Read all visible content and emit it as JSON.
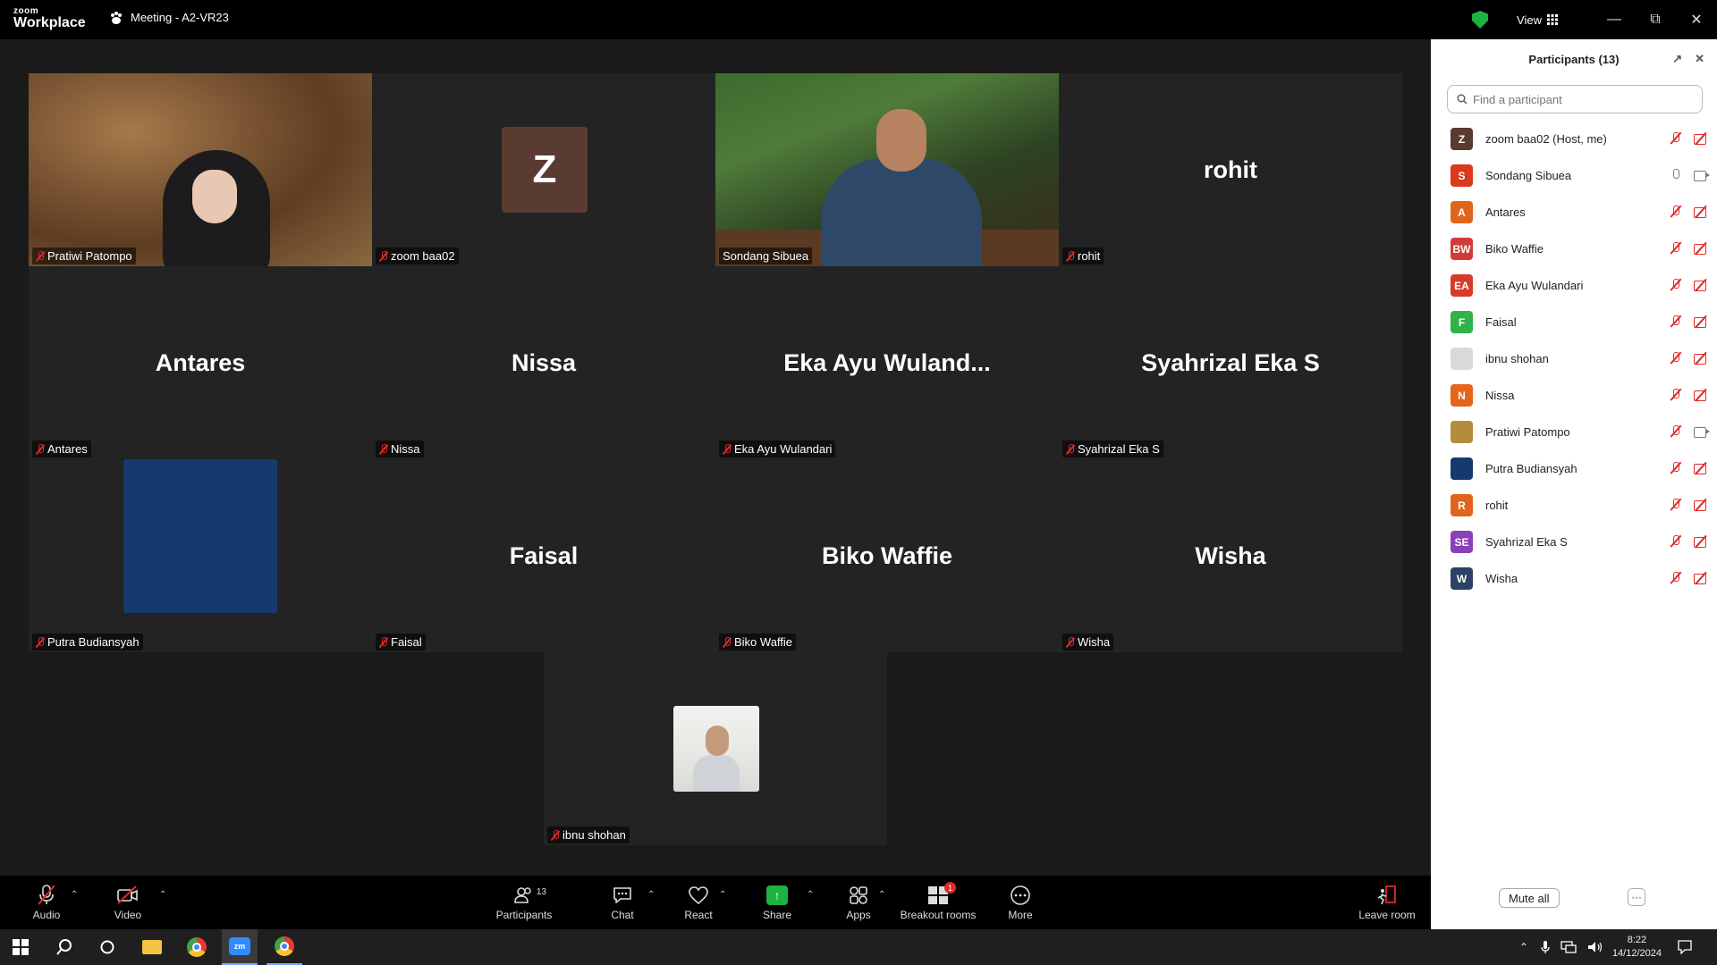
{
  "app": {
    "logo_line1": "zoom",
    "logo_line2": "Workplace",
    "meeting_title": "Meeting - A2-VR23",
    "view_label": "View",
    "accent_green": "#25d366",
    "mute_red": "#e02828"
  },
  "tiles": [
    {
      "id": "pratiwi",
      "tag": "Pratiwi Patompo",
      "big": "",
      "type": "video"
    },
    {
      "id": "zoom",
      "tag": "zoom baa02",
      "big": "",
      "avatar_letter": "Z",
      "type": "avatar"
    },
    {
      "id": "sondang",
      "tag": "Sondang Sibuea",
      "big": "",
      "type": "video",
      "active": true
    },
    {
      "id": "rohit",
      "tag": "rohit",
      "big": "rohit",
      "type": "name"
    },
    {
      "id": "antares",
      "tag": "Antares",
      "big": "Antares",
      "type": "name"
    },
    {
      "id": "nissa",
      "tag": "Nissa",
      "big": "Nissa",
      "type": "name"
    },
    {
      "id": "eka",
      "tag": "Eka Ayu Wulandari",
      "big": "Eka Ayu Wuland...",
      "type": "name"
    },
    {
      "id": "syahrizal",
      "tag": "Syahrizal Eka S",
      "big": "Syahrizal Eka S",
      "type": "name"
    },
    {
      "id": "putra",
      "tag": "Putra Budiansyah",
      "big": "",
      "type": "blue"
    },
    {
      "id": "faisal",
      "tag": "Faisal",
      "big": "Faisal",
      "type": "name"
    },
    {
      "id": "biko",
      "tag": "Biko Waffie",
      "big": "Biko Waffie",
      "type": "name"
    },
    {
      "id": "wisha",
      "tag": "Wisha",
      "big": "Wisha",
      "type": "name"
    },
    {
      "id": "ibnu",
      "tag": "ibnu shohan",
      "big": "",
      "type": "photo"
    }
  ],
  "panel": {
    "title": "Participants (13)",
    "search_placeholder": "Find a participant",
    "mute_all": "Mute all",
    "more": "···",
    "participants": [
      {
        "avatar": "Z",
        "color": "#5a3b32",
        "name": "zoom baa02 (Host, me)",
        "mic": "muted",
        "cam": "off"
      },
      {
        "avatar": "S",
        "color": "#d93b1c",
        "name": "Sondang Sibuea",
        "mic": "on",
        "cam": "on"
      },
      {
        "avatar": "A",
        "color": "#e0651a",
        "name": "Antares",
        "mic": "muted",
        "cam": "off"
      },
      {
        "avatar": "BW",
        "color": "#d23a3a",
        "name": "Biko Waffie",
        "mic": "muted",
        "cam": "off"
      },
      {
        "avatar": "EA",
        "color": "#d63b2a",
        "name": "Eka Ayu Wulandari",
        "mic": "muted",
        "cam": "off"
      },
      {
        "avatar": "F",
        "color": "#2fb34a",
        "name": "Faisal",
        "mic": "muted",
        "cam": "off"
      },
      {
        "avatar": "",
        "color": "#d9d9d9",
        "name": "ibnu shohan",
        "mic": "muted",
        "cam": "off"
      },
      {
        "avatar": "N",
        "color": "#e4651b",
        "name": "Nissa",
        "mic": "muted",
        "cam": "off"
      },
      {
        "avatar": "",
        "color": "#b58b3d",
        "name": "Pratiwi Patompo",
        "mic": "muted",
        "cam": "on"
      },
      {
        "avatar": "",
        "color": "#173a6e",
        "name": "Putra Budiansyah",
        "mic": "muted",
        "cam": "off"
      },
      {
        "avatar": "R",
        "color": "#e0651a",
        "name": "rohit",
        "mic": "muted",
        "cam": "off"
      },
      {
        "avatar": "SE",
        "color": "#8b3fb8",
        "name": "Syahrizal Eka S",
        "mic": "muted",
        "cam": "off"
      },
      {
        "avatar": "W",
        "color": "#2c4163",
        "name": "Wisha",
        "mic": "muted",
        "cam": "off"
      }
    ]
  },
  "toolbar": {
    "audio": "Audio",
    "video": "Video",
    "participants": "Participants",
    "participants_count": "13",
    "chat": "Chat",
    "react": "React",
    "share": "Share",
    "apps": "Apps",
    "breakout": "Breakout rooms",
    "breakout_badge": "1",
    "more": "More",
    "leave": "Leave room"
  },
  "taskbar": {
    "time": "8:22",
    "date": "14/12/2024",
    "zm_label": "zm"
  }
}
